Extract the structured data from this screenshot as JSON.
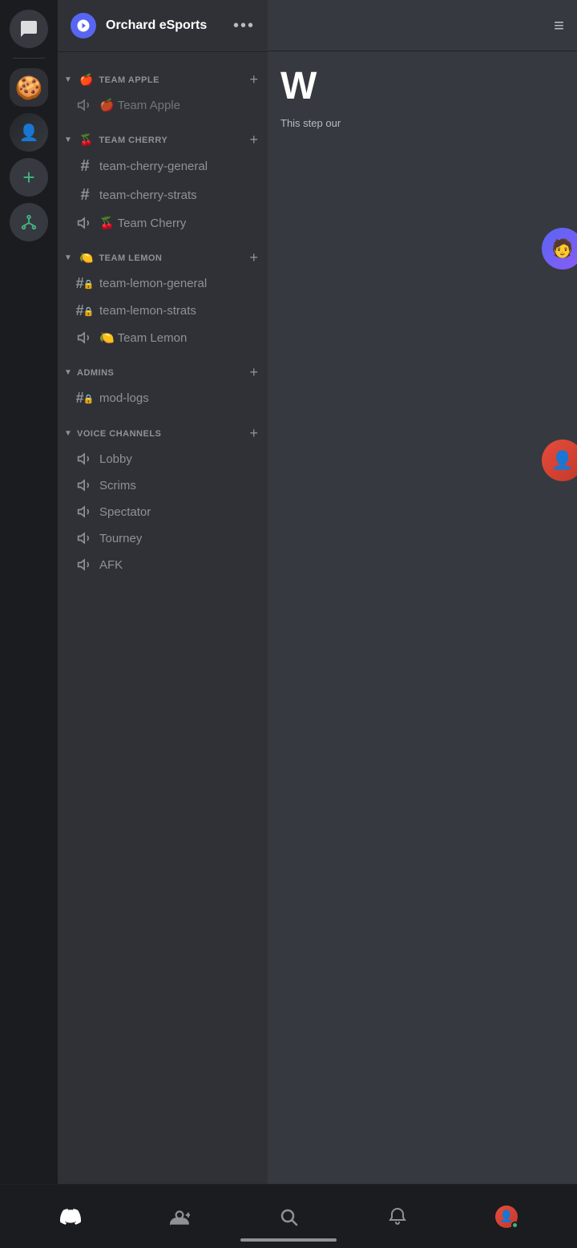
{
  "server": {
    "name": "Orchard eSports",
    "icon": "⚙️"
  },
  "categories": [
    {
      "id": "team-apple",
      "name": "TEAM APPLE",
      "emoji": "🍎",
      "expanded": true,
      "channels": [
        {
          "id": "team-apple-voice",
          "name": "Team Apple",
          "type": "voice",
          "emoji": "🍎",
          "locked": false
        }
      ]
    },
    {
      "id": "team-cherry",
      "name": "TEAM CHERRY",
      "emoji": "🍒",
      "expanded": true,
      "channels": [
        {
          "id": "team-cherry-general",
          "name": "team-cherry-general",
          "type": "text",
          "locked": false
        },
        {
          "id": "team-cherry-strats",
          "name": "team-cherry-strats",
          "type": "text",
          "locked": false
        },
        {
          "id": "team-cherry-voice",
          "name": "Team Cherry",
          "type": "voice",
          "emoji": "🍒",
          "locked": false
        }
      ]
    },
    {
      "id": "team-lemon",
      "name": "TEAM LEMON",
      "emoji": "🍋",
      "expanded": true,
      "channels": [
        {
          "id": "team-lemon-general",
          "name": "team-lemon-general",
          "type": "text",
          "locked": true
        },
        {
          "id": "team-lemon-strats",
          "name": "team-lemon-strats",
          "type": "text",
          "locked": true
        },
        {
          "id": "team-lemon-voice",
          "name": "Team Lemon",
          "type": "voice",
          "emoji": "🍋",
          "locked": false
        }
      ]
    },
    {
      "id": "admins",
      "name": "ADMINS",
      "emoji": "",
      "expanded": true,
      "channels": [
        {
          "id": "mod-logs",
          "name": "mod-logs",
          "type": "text",
          "locked": true
        }
      ]
    },
    {
      "id": "voice-channels",
      "name": "VOICE CHANNELS",
      "emoji": "",
      "expanded": true,
      "channels": [
        {
          "id": "lobby",
          "name": "Lobby",
          "type": "voice",
          "locked": false
        },
        {
          "id": "scrims",
          "name": "Scrims",
          "type": "voice",
          "locked": false
        },
        {
          "id": "spectator",
          "name": "Spectator",
          "type": "voice",
          "locked": false
        },
        {
          "id": "tourney",
          "name": "Tourney",
          "type": "voice",
          "locked": false
        },
        {
          "id": "afk",
          "name": "AFK",
          "type": "voice",
          "locked": false
        }
      ]
    }
  ],
  "right_panel": {
    "letter": "W",
    "subtext": "This step our"
  },
  "bottom_nav": {
    "items": [
      {
        "id": "home",
        "label": "Home",
        "icon": "discord"
      },
      {
        "id": "friends",
        "label": "Friends",
        "icon": "person"
      },
      {
        "id": "search",
        "label": "Search",
        "icon": "search"
      },
      {
        "id": "notifications",
        "label": "Notifications",
        "icon": "bell"
      },
      {
        "id": "profile",
        "label": "Profile",
        "icon": "avatar"
      }
    ]
  },
  "colors": {
    "bg_dark": "#1e2124",
    "bg_sidebar": "#2f3136",
    "bg_channel": "#36393f",
    "accent": "#5865f2",
    "text_normal": "#dcddde",
    "text_muted": "#8e9297",
    "green": "#43b581"
  }
}
